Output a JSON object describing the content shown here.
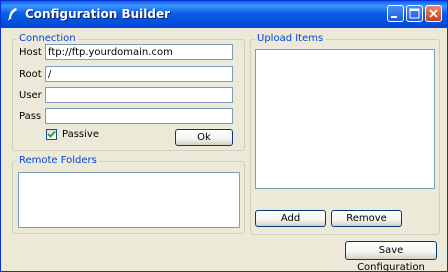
{
  "window": {
    "title": "Configuration Builder",
    "icon": "feather-icon",
    "controls": [
      "minimize-icon",
      "maximize-icon",
      "close-icon"
    ]
  },
  "connection": {
    "legend": "Connection",
    "host_label": "Host",
    "host_value": "ftp://ftp.yourdomain.com",
    "root_label": "Root",
    "root_value": "/",
    "user_label": "User",
    "user_value": "",
    "pass_label": "Pass",
    "pass_value": "",
    "passive_label": "Passive",
    "passive_checked": true,
    "ok_label": "Ok"
  },
  "remote_folders": {
    "legend": "Remote Folders",
    "items": []
  },
  "upload_items": {
    "legend": "Upload Items",
    "items": [],
    "add_label": "Add",
    "remove_label": "Remove"
  },
  "footer": {
    "save_label": "Save Configuration"
  },
  "colors": {
    "titlebar": "#0a5fe8",
    "legend_text": "#0046d5",
    "dialog_face": "#ece9d8",
    "close_button": "#c4401f"
  }
}
